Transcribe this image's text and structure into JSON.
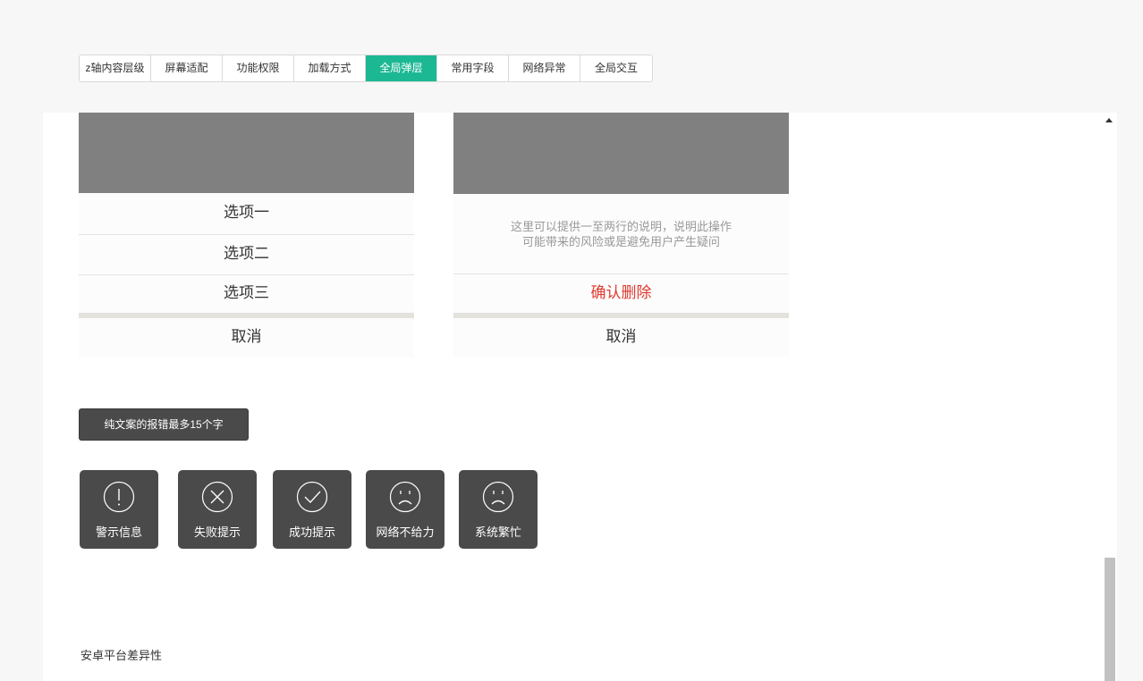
{
  "tabs": [
    {
      "label": "z轴内容层级",
      "active": false
    },
    {
      "label": "屏幕适配",
      "active": false
    },
    {
      "label": "功能权限",
      "active": false
    },
    {
      "label": "加载方式",
      "active": false
    },
    {
      "label": "全局弹层",
      "active": true
    },
    {
      "label": "常用字段",
      "active": false
    },
    {
      "label": "网络异常",
      "active": false
    },
    {
      "label": "全局交互",
      "active": false
    }
  ],
  "action_sheet_options": {
    "items": [
      "选项一",
      "选项二",
      "选项三"
    ],
    "cancel": "取消"
  },
  "action_sheet_confirm": {
    "desc_line1": "这里可以提供一至两行的说明，说明此操作",
    "desc_line2": "可能带来的风险或是避免用户产生疑问",
    "confirm": "确认删除",
    "cancel": "取消"
  },
  "text_toast": "纯文案的报错最多15个字",
  "icon_toasts": [
    {
      "icon": "exclamation-icon",
      "label": "警示信息"
    },
    {
      "icon": "close-x-icon",
      "label": "失败提示"
    },
    {
      "icon": "checkmark-icon",
      "label": "成功提示"
    },
    {
      "icon": "sad-face-icon",
      "label": "网络不给力"
    },
    {
      "icon": "sad-face-icon",
      "label": "系统繁忙"
    }
  ],
  "section_title": "安卓平台差异性",
  "colors": {
    "accent": "#1cb894",
    "danger": "#e03a2f",
    "toast_bg": "#4a4a4a"
  }
}
